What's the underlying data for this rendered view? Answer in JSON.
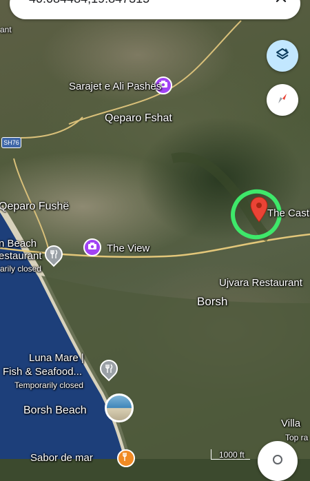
{
  "search": {
    "query": "40.084484,19.847315"
  },
  "places": {
    "sarajet": "Sarajet e Ali Pashës",
    "qeparo_fshat": "Qeparo Fshat",
    "qeparo_fushe": "Qeparo Fushë",
    "the_castle": "The Castl",
    "the_view": "The View",
    "beach_restaurant_line1": "n Beach",
    "beach_restaurant_line2": "estaurant",
    "beach_restaurant_status": "arily closed",
    "ujvara": "Ujvara Restaurant",
    "borsh": "Borsh",
    "luna_mare_line1": "Luna Mare |",
    "luna_mare_line2": "Fish & Seafood...",
    "luna_mare_status": "Temporarily closed",
    "borsh_beach": "Borsh Beach",
    "villa": "Villa",
    "villa_sub": "Top ra",
    "sabor": "Sabor de mar",
    "edge_top_left": "ant"
  },
  "road": {
    "shield": "SH76"
  },
  "scale": {
    "label": "1000 ft"
  },
  "icons": {
    "layers": "layers-icon",
    "compass": "compass-icon",
    "close": "close-icon",
    "pin": "map-pin-icon",
    "camera": "camera-icon",
    "restaurant": "restaurant-icon"
  },
  "colors": {
    "layers_bg": "#c2e7ff",
    "pin": "#ea4335",
    "poi_purple": "#a142f4",
    "poi_orange": "#f08a24",
    "highlight_stroke": "#3ee86a",
    "sea": "#1d3f7a"
  }
}
